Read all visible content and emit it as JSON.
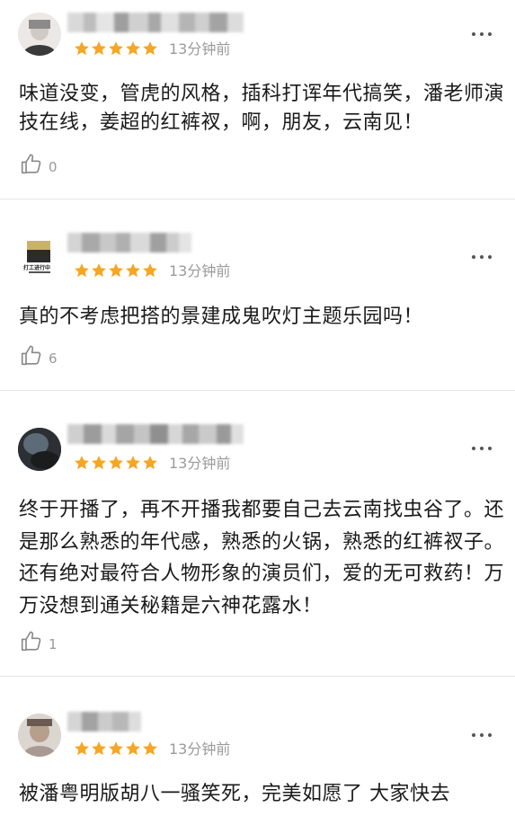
{
  "comments": [
    {
      "time": "13分钟前",
      "text": "味道没变，管虎的风格，插科打诨年代搞笑，潘老师演技在线，姜超的红裤衩，啊，朋友，云南见！",
      "likes": "0",
      "rating": 5
    },
    {
      "time": "13分钟前",
      "text": "真的不考虑把搭的景建成鬼吹灯主题乐园吗！",
      "likes": "6",
      "rating": 5,
      "avatar_caption": "打工进行中"
    },
    {
      "time": "13分钟前",
      "text": "终于开播了，再不开播我都要自己去云南找虫谷了。还是那么熟悉的年代感，熟悉的火锅，熟悉的红裤衩子。还有绝对最符合人物形象的演员们，爱的无可救药！万万没想到通关秘籍是六神花露水！",
      "likes": "1",
      "rating": 5
    },
    {
      "time": "13分钟前",
      "text": "被潘粤明版胡八一骚笑死，完美如愿了 大家快去",
      "rating": 5
    }
  ],
  "colors": {
    "star": "#f5a623",
    "muted": "#9a9a9a",
    "text": "#1a1a1a",
    "divider": "#e6e6e6"
  },
  "icons": {
    "like": "thumbs-up-icon",
    "more": "more-dots-icon",
    "star": "star-icon"
  }
}
